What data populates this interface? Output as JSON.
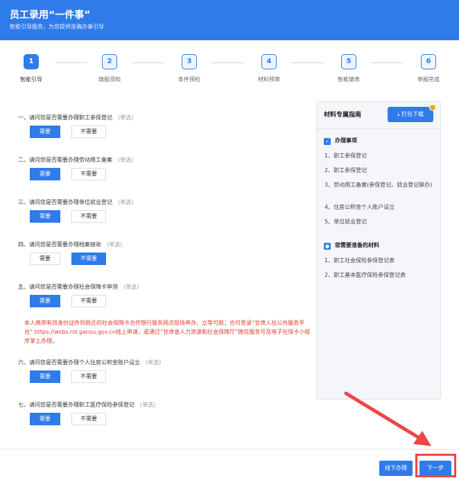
{
  "header": {
    "title": "员工录用“一件事”",
    "subtitle": "智能引导服务，为您提供准确办事引导"
  },
  "steps": [
    {
      "num": "1",
      "label": "智能引导",
      "active": true
    },
    {
      "num": "2",
      "label": "填报须知",
      "active": false
    },
    {
      "num": "3",
      "label": "条件预检",
      "active": false
    },
    {
      "num": "4",
      "label": "材料预审",
      "active": false
    },
    {
      "num": "5",
      "label": "智能填表",
      "active": false
    },
    {
      "num": "6",
      "label": "申报完成",
      "active": false
    }
  ],
  "questions": [
    {
      "text": "一、请问您是否需要办理职工参保登记",
      "hint": "(单选)",
      "options": [
        "需要",
        "不需要"
      ],
      "selected": "需要"
    },
    {
      "text": "二、请问您是否需要办理劳动用工备案",
      "hint": "(单选)",
      "options": [
        "需要",
        "不需要"
      ],
      "selected": "需要"
    },
    {
      "text": "三、请问您是否需要办理单位就业登记",
      "hint": "(单选)",
      "options": [
        "需要",
        "不需要"
      ],
      "selected": "需要"
    },
    {
      "text": "四、请问您是否需要办理档案接收",
      "hint": "(单选)",
      "options": [
        "需要",
        "不需要"
      ],
      "selected": "不需要"
    },
    {
      "text": "五、请问您是否需要办理社会保障卡申领",
      "hint": "(单选)",
      "options": [
        "需要",
        "不需要"
      ],
      "selected": "需要"
    },
    {
      "text": "六、请问您是否需要办理个人住房公积金账户设立",
      "hint": "(单选)",
      "options": [
        "需要",
        "不需要"
      ],
      "selected": "需要"
    },
    {
      "text": "七、请问您是否需要办理职工医疗保险参保登记",
      "hint": "(单选)",
      "options": [
        "需要",
        "不需要"
      ],
      "selected": "需要"
    }
  ],
  "notice": "本人携带有效身份证件到就近的社会保障卡合作银行服务网点现场申办、立等可取；也可登录“甘肃人社公共服务平台” https://wsbs.rst.gansu.gov.cn线上申请，或通过“甘肃省人力资源和社会保障厅”微信服务号及电子社保卡小程序掌上办理。",
  "panel": {
    "title": "材料专属指南",
    "download_label": "打包下载",
    "section1_title": "办理事项",
    "section1_items": [
      "1、职工参保登记",
      "2、职工参保登记",
      "3、劳动用工备案(参保登记、就业登记联办)",
      "4、住房公积金个人账户设立",
      "5、单位就业登记"
    ],
    "section2_title": "您需要准备的材料",
    "section2_items": [
      "1、职工社会保险参保登记表",
      "2、职工基本医疗保险参保登记表"
    ]
  },
  "footer": {
    "offline_label": "线下办理",
    "next_label": "下一步"
  },
  "colors": {
    "primary": "#2f7bea",
    "notice": "#e23b2e",
    "annotation": "#ef4545"
  }
}
